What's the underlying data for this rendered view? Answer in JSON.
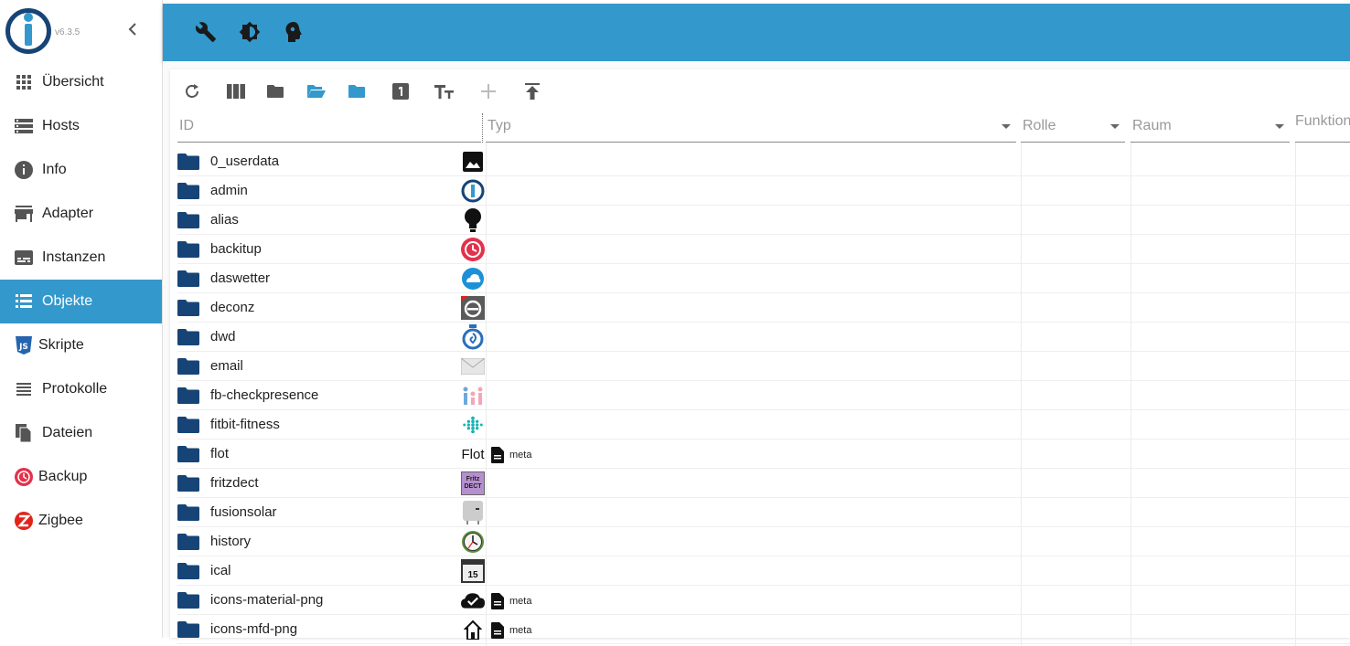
{
  "app": {
    "version": "v6.3.5"
  },
  "sidebar": {
    "items": [
      {
        "label": "Übersicht",
        "icon": "grid-icon",
        "active": false
      },
      {
        "label": "Hosts",
        "icon": "storage-icon",
        "active": false
      },
      {
        "label": "Info",
        "icon": "info-icon",
        "active": false
      },
      {
        "label": "Adapter",
        "icon": "store-icon",
        "active": false
      },
      {
        "label": "Instanzen",
        "icon": "subtitles-icon",
        "active": false
      },
      {
        "label": "Objekte",
        "icon": "list-icon",
        "active": true
      },
      {
        "label": "Skripte",
        "icon": "javascript-icon",
        "active": false
      },
      {
        "label": "Protokolle",
        "icon": "log-lines-icon",
        "active": false
      },
      {
        "label": "Dateien",
        "icon": "files-icon",
        "active": false
      },
      {
        "label": "Backup",
        "icon": "backup-icon",
        "active": false
      },
      {
        "label": "Zigbee",
        "icon": "zigbee-icon",
        "active": false
      }
    ]
  },
  "header": {
    "buttons": [
      "wrench-icon",
      "brightness-icon",
      "expert-mode-icon"
    ]
  },
  "toolbar": {
    "buttons": [
      "refresh-icon",
      "columns-icon",
      "folder-icon",
      "folder-open-icon",
      "folder-blue-icon",
      "counter-one-icon",
      "text-size-icon",
      "add-icon",
      "upload-icon"
    ]
  },
  "table": {
    "columns": {
      "id": "ID",
      "typ": "Typ",
      "rolle": "Rolle",
      "raum": "Raum",
      "funktion": "Funktion"
    },
    "rows": [
      {
        "name": "0_userdata",
        "icon": "image-icon",
        "meta": ""
      },
      {
        "name": "admin",
        "icon": "iobroker-logo-icon",
        "meta": ""
      },
      {
        "name": "alias",
        "icon": "lightbulb-icon",
        "meta": ""
      },
      {
        "name": "backitup",
        "icon": "backitup-icon",
        "meta": ""
      },
      {
        "name": "daswetter",
        "icon": "daswetter-icon",
        "meta": ""
      },
      {
        "name": "deconz",
        "icon": "deconz-icon",
        "meta": ""
      },
      {
        "name": "dwd",
        "icon": "dwd-icon",
        "meta": ""
      },
      {
        "name": "email",
        "icon": "envelope-icon",
        "meta": ""
      },
      {
        "name": "fb-checkpresence",
        "icon": "people-icon",
        "meta": ""
      },
      {
        "name": "fitbit-fitness",
        "icon": "fitbit-icon",
        "meta": ""
      },
      {
        "name": "flot",
        "icon": "flot-icon",
        "icon_text": "Flot",
        "meta": "meta"
      },
      {
        "name": "fritzdect",
        "icon": "fritzdect-icon",
        "icon_text": "Fritz DECT",
        "meta": ""
      },
      {
        "name": "fusionsolar",
        "icon": "inverter-icon",
        "meta": ""
      },
      {
        "name": "history",
        "icon": "clock-icon",
        "meta": ""
      },
      {
        "name": "ical",
        "icon": "calendar-icon",
        "icon_text": "15",
        "meta": ""
      },
      {
        "name": "icons-material-png",
        "icon": "cloud-check-icon",
        "meta": "meta"
      },
      {
        "name": "icons-mfd-png",
        "icon": "house-icon",
        "meta": "meta"
      }
    ]
  },
  "colors": {
    "accent": "#3399cc",
    "folder": "#164477"
  }
}
